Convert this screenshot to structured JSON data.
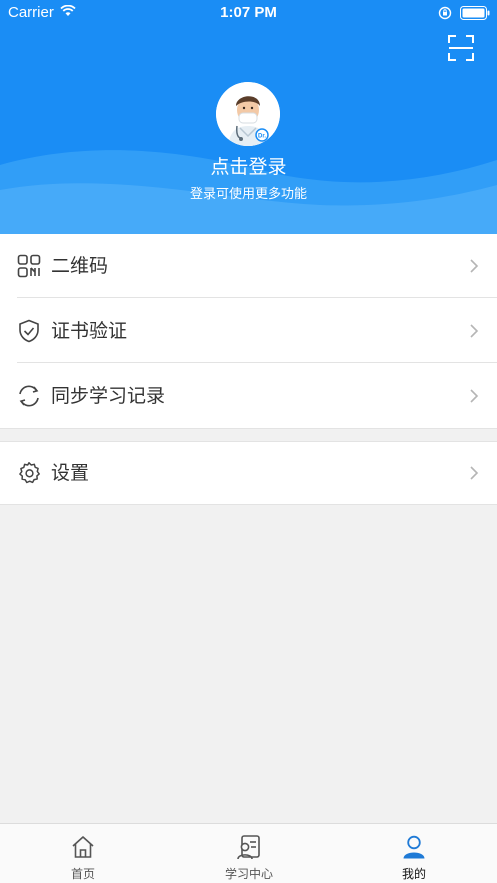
{
  "status_bar": {
    "carrier": "Carrier",
    "time": "1:07 PM"
  },
  "profile": {
    "login_title": "点击登录",
    "login_subtitle": "登录可使用更多功能"
  },
  "menu": {
    "items": [
      {
        "label": "二维码",
        "icon": "qrcode-icon"
      },
      {
        "label": "证书验证",
        "icon": "shield-check-icon"
      },
      {
        "label": "同步学习记录",
        "icon": "sync-icon"
      }
    ],
    "settings": {
      "label": "设置",
      "icon": "gear-icon"
    }
  },
  "tabbar": {
    "tabs": [
      {
        "label": "首页",
        "icon": "home-icon"
      },
      {
        "label": "学习中心",
        "icon": "study-center-icon"
      },
      {
        "label": "我的",
        "icon": "user-icon",
        "active": true
      }
    ]
  },
  "colors": {
    "header": "#1a8df5",
    "active_tab_icon": "#1f7ad6"
  }
}
